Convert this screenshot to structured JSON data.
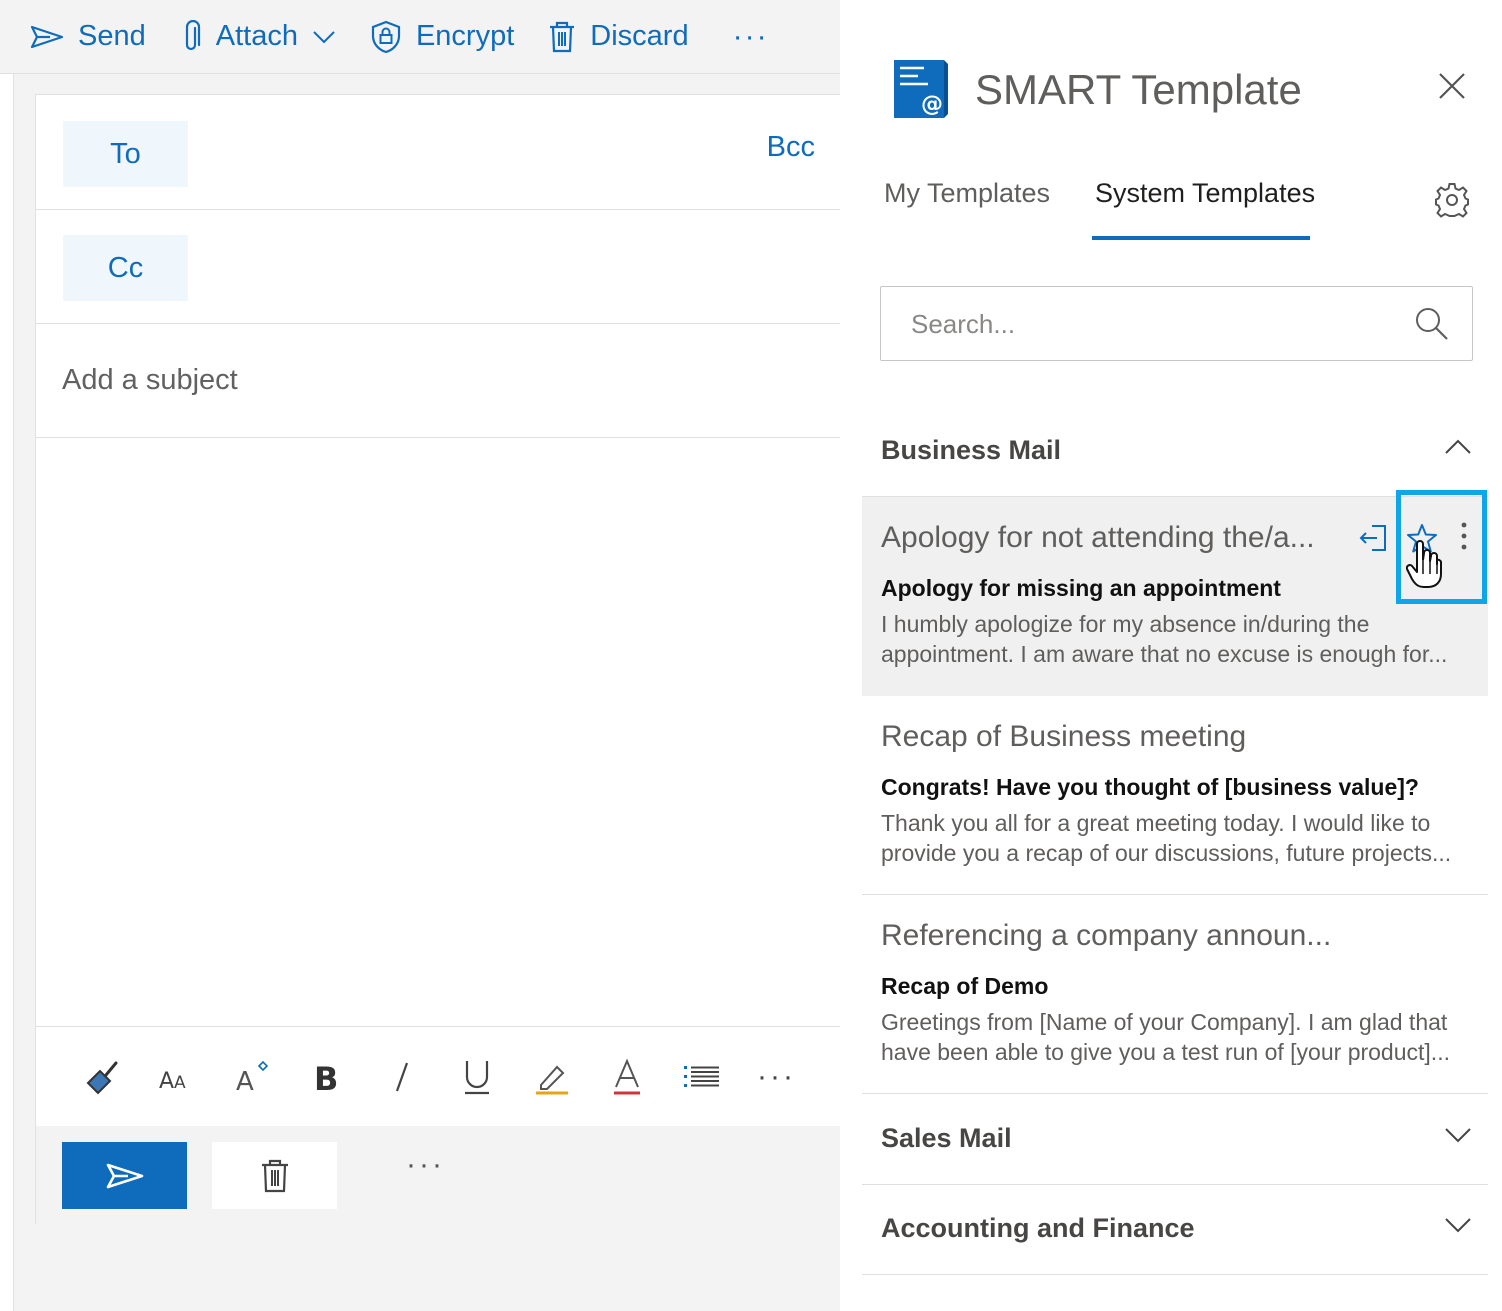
{
  "toolbar": {
    "send_label": "Send",
    "attach_label": "Attach",
    "encrypt_label": "Encrypt",
    "discard_label": "Discard",
    "more_label": "···"
  },
  "compose": {
    "to_label": "To",
    "cc_label": "Cc",
    "bcc_label": "Bcc",
    "subject_placeholder": "Add a subject",
    "format_more": "···",
    "actions_more": "···"
  },
  "addin": {
    "title": "SMART Template",
    "tabs": [
      {
        "label": "My Templates",
        "selected": false
      },
      {
        "label": "System Templates",
        "selected": true
      }
    ],
    "search_placeholder": "Search...",
    "categories": [
      {
        "label": "Business Mail",
        "expanded": true,
        "templates": [
          {
            "title": "Apology for not attending the/a...",
            "subject": "Apology for missing an appointment",
            "preview_line1": "I humbly apologize for my absence in/during the",
            "preview_line2": "appointment. I am aware that no excuse is enough for..."
          },
          {
            "title": "Recap of Business meeting",
            "subject": "Congrats! Have you thought of [business value]?",
            "preview_line1": "Thank you all for a great meeting today. I would like to",
            "preview_line2": "provide you a recap of our discussions, future projects..."
          },
          {
            "title": "Referencing a company announ...",
            "subject": "Recap of Demo",
            "preview_line1": "Greetings from [Name of your Company]. I am glad that I",
            "preview_line2": "have been able to give you a test run of [your product]..."
          }
        ]
      },
      {
        "label": "Sales Mail",
        "expanded": false
      },
      {
        "label": "Accounting and Finance",
        "expanded": false
      }
    ]
  },
  "colors": {
    "accent": "#0f6cbd",
    "highlight": "#0ea5e9",
    "pane_bg": "#ffffff",
    "compose_bg": "#f3f3f3",
    "active_item_bg": "#f0f0f0"
  }
}
